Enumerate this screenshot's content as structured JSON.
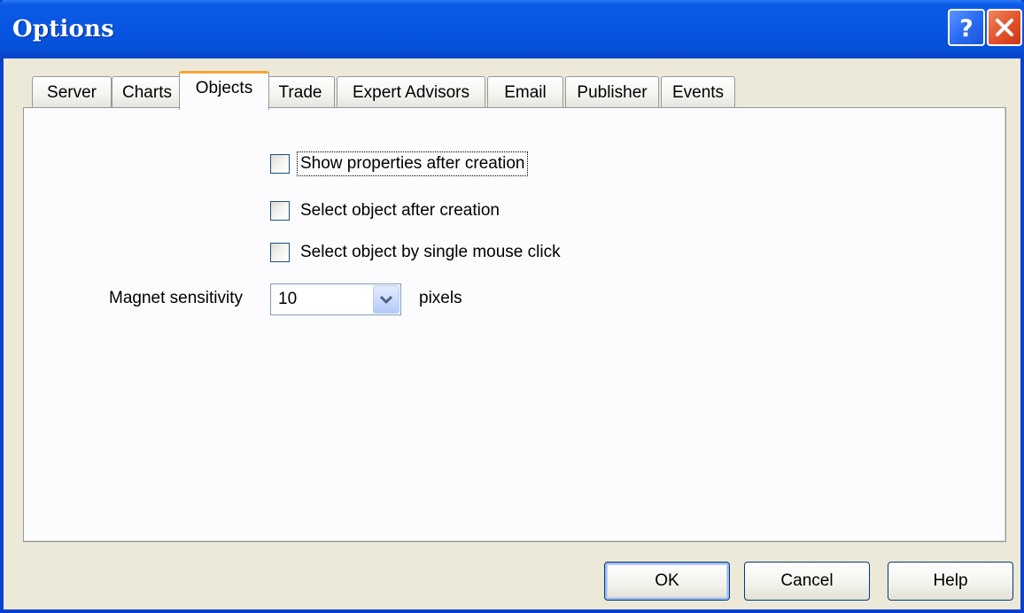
{
  "window": {
    "title": "Options",
    "help_icon": "question-mark-icon",
    "close_icon": "close-x-icon"
  },
  "tabs": [
    {
      "label": "Server"
    },
    {
      "label": "Charts"
    },
    {
      "label": "Objects",
      "active": true
    },
    {
      "label": "Trade"
    },
    {
      "label": "Expert Advisors"
    },
    {
      "label": "Email"
    },
    {
      "label": "Publisher"
    },
    {
      "label": "Events"
    }
  ],
  "objects": {
    "show_properties_label": "Show properties after creation",
    "show_properties_checked": false,
    "select_after_creation_label": "Select object after creation",
    "select_after_creation_checked": false,
    "select_single_click_label": "Select object by single mouse click",
    "select_single_click_checked": false,
    "magnet_label": "Magnet sensitivity",
    "magnet_value": "10",
    "magnet_unit": "pixels"
  },
  "buttons": {
    "ok": "OK",
    "cancel": "Cancel",
    "help": "Help"
  },
  "colors": {
    "titlebar": "#0755e1",
    "close_button": "#e2512a",
    "active_tab_accent": "#f5a53a",
    "window_background": "#ece9d8"
  }
}
